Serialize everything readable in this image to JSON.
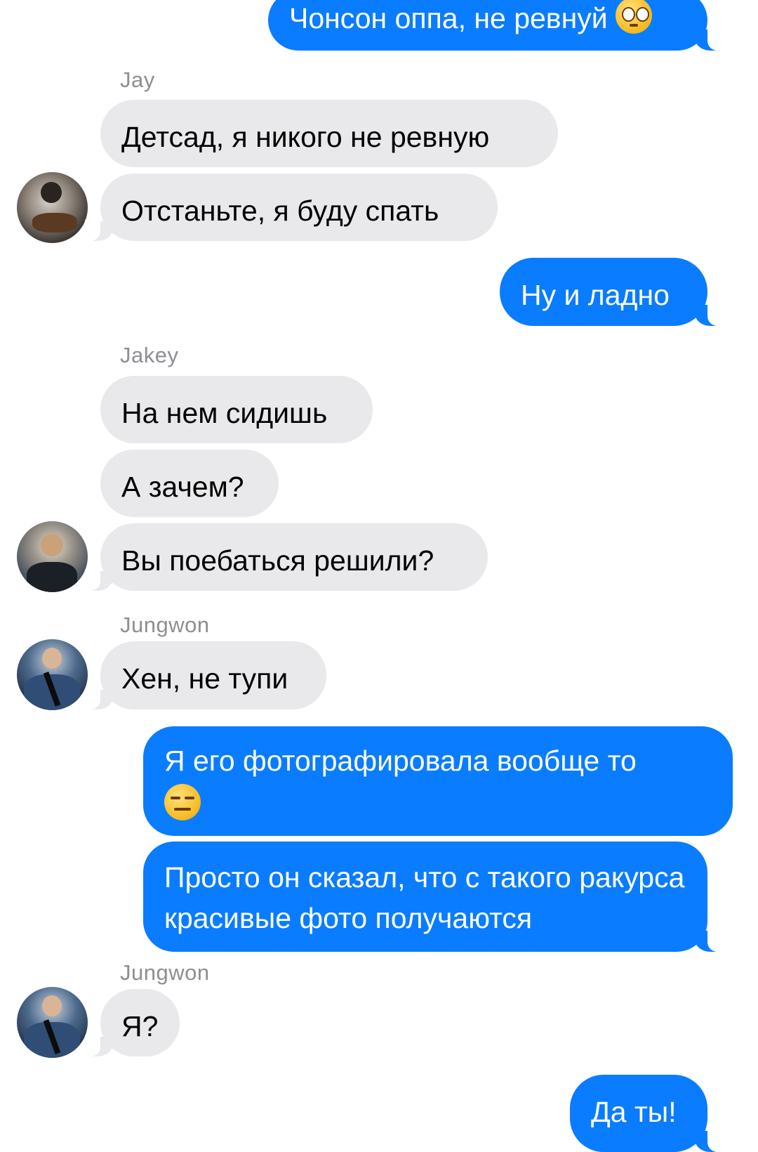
{
  "messages": [
    {
      "text": "Чонсон оппа, не ревнуй",
      "emoji": "pleading-face"
    },
    {
      "sender": "Jay"
    },
    {
      "text": "Детсад, я никого не ревную"
    },
    {
      "text": "Отстаньте, я буду спать"
    },
    {
      "text": "Ну и ладно"
    },
    {
      "sender": "Jakey"
    },
    {
      "text": "На нем сидишь"
    },
    {
      "text": "А зачем?"
    },
    {
      "text": "Вы поебаться решили?"
    },
    {
      "sender": "Jungwon"
    },
    {
      "text": "Хен, не тупи"
    },
    {
      "text": "Я его фотографировала вообще то",
      "emoji": "expressionless-face"
    },
    {
      "text": "Просто он сказал, что с такого ракурса красивые фото получаются"
    },
    {
      "sender": "Jungwon"
    },
    {
      "text": "Я?"
    },
    {
      "text": "Да ты!"
    }
  ],
  "colors": {
    "outgoing": "#0a7cff",
    "incoming": "#e9e9eb",
    "sender": "#8e8e93"
  }
}
